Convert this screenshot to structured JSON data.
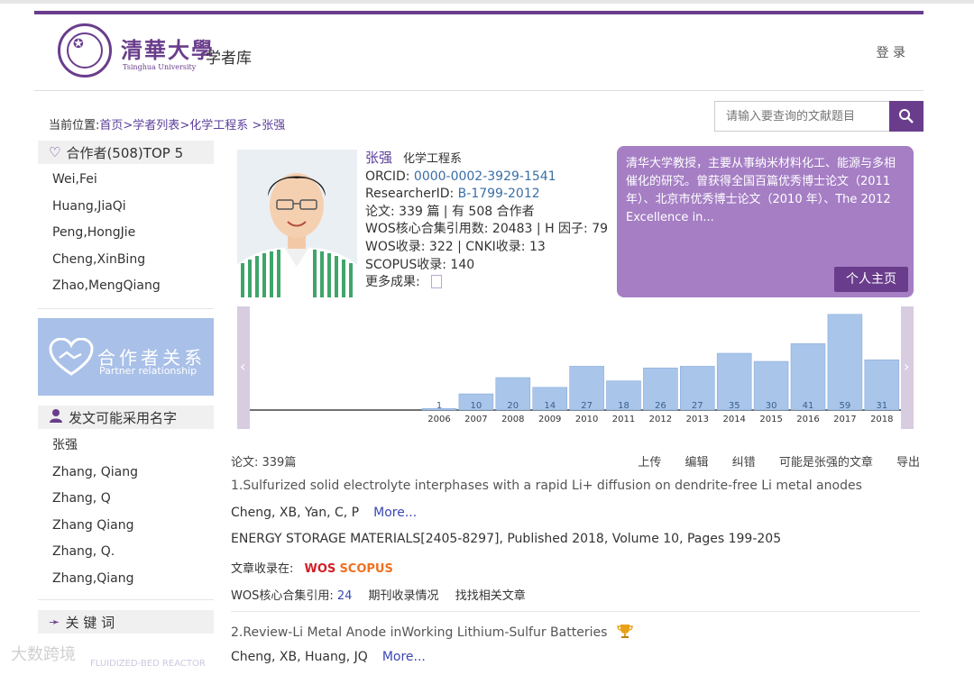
{
  "header": {
    "logo_cn": "清華大學",
    "logo_en": "Tsinghua University",
    "library": "学者库",
    "login": "登 录"
  },
  "breadcrumb": {
    "prefix": "当前位置:",
    "items": [
      "首页",
      ">学者列表",
      ">化学工程系",
      " >张强"
    ]
  },
  "search": {
    "placeholder": "请输入要查询的文献题目"
  },
  "coauthors": {
    "title": "合作者(508)TOP 5",
    "items": [
      "Wei,Fei",
      "Huang,JiaQi",
      "Peng,HongJie",
      "Cheng,XinBing",
      "Zhao,MengQiang"
    ]
  },
  "partner": {
    "title": "合作者关系",
    "subtitle": "Partner relationship"
  },
  "names": {
    "title": "发文可能采用名字",
    "items": [
      "张强",
      "Zhang, Qiang",
      "Zhang, Q",
      "Zhang Qiang",
      "Zhang, Q.",
      "Zhang,Qiang"
    ]
  },
  "keywords": {
    "title": "关 键 词",
    "first": "FLUIDIZED-BED REACTOR"
  },
  "profile": {
    "name": "张强",
    "dept": "化学工程系",
    "orcid_label": "ORCID: ",
    "orcid": "0000-0002-3929-1541",
    "rid_label": "ResearcherID: ",
    "rid": "B-1799-2012",
    "papers_line": "论文: 339 篇 | 有 508 合作者",
    "wos_line": "WOS核心合集引用数: 20483 | H 因子: 79",
    "wos_cnki": "WOS收录: 322 | CNKI收录: 13",
    "scopus": "SCOPUS收录: 140",
    "more": "更多成果:"
  },
  "bio": {
    "text": "清华大学教授，主要从事纳米材料化工、能源与多相催化的研究。曾获得全国百篇优秀博士论文（2011 年）、北京市优秀博士论文（2010 年）、The 2012 Excellence in...",
    "button": "个人主页"
  },
  "chart_data": {
    "type": "bar",
    "categories": [
      "2006",
      "2007",
      "2008",
      "2009",
      "2010",
      "2011",
      "2012",
      "2013",
      "2014",
      "2015",
      "2016",
      "2017",
      "2018"
    ],
    "values": [
      1,
      10,
      20,
      14,
      27,
      18,
      26,
      27,
      35,
      30,
      41,
      59,
      31
    ],
    "ylim": [
      0,
      60
    ],
    "color": "#a9c5ea"
  },
  "papers": {
    "count_label": "论文: 339篇",
    "actions": [
      "上传",
      "编辑",
      "纠错",
      "可能是张强的文章",
      "导出"
    ],
    "list": [
      {
        "title": "1.Sulfurized solid electrolyte interphases with a rapid Li+ diffusion on dendrite-free Li metal anodes",
        "authors": "Cheng, XB, Yan, C, P",
        "more": "More...",
        "source": "ENERGY STORAGE MATERIALS[2405-8297], Published 2018, Volume 10, Pages 199-205",
        "indexed_label": "文章收录在:",
        "wos": "WOS",
        "scopus": "SCOPUS",
        "cite_label": "WOS核心合集引用: ",
        "cites": "24",
        "journal_info": "期刊收录情况",
        "related": "找找相关文章"
      },
      {
        "title": "2.Review-Li Metal Anode inWorking Lithium-Sulfur Batteries",
        "authors": "Cheng, XB, Huang, JQ",
        "more": "More..."
      }
    ]
  },
  "watermark": "大数跨境"
}
